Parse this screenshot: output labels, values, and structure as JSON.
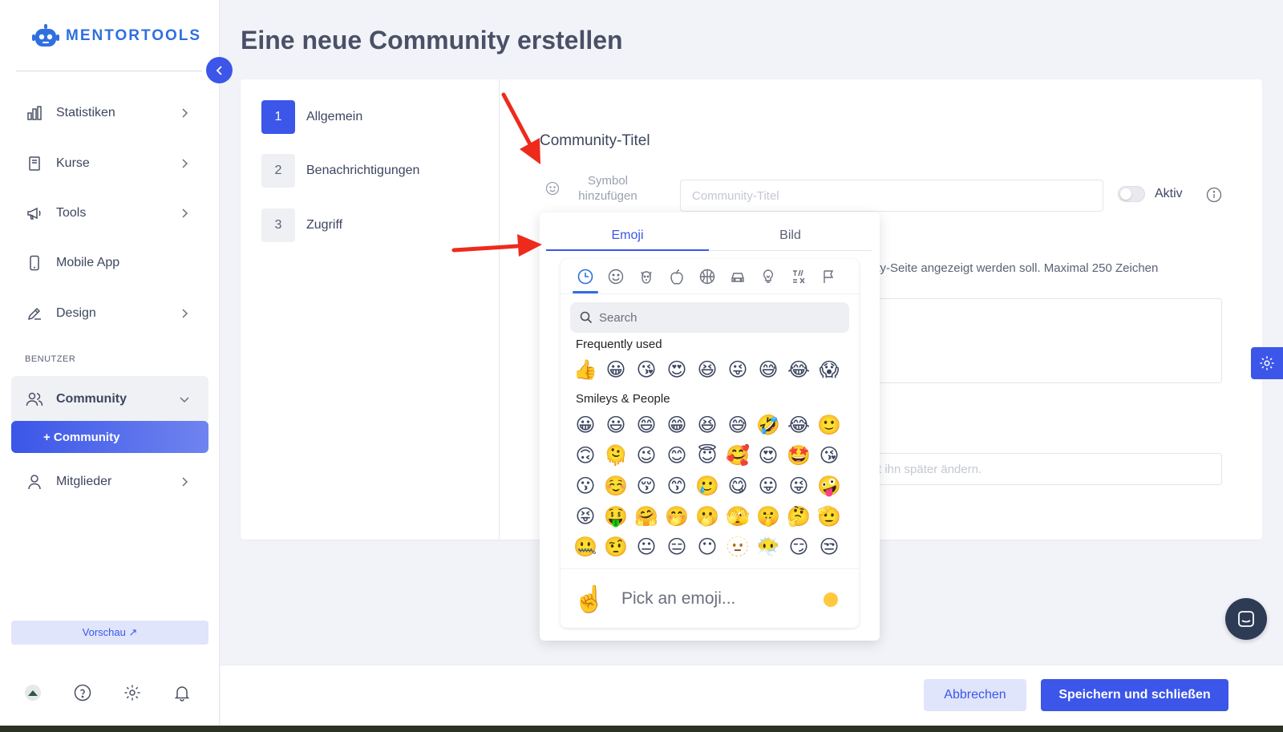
{
  "brand": {
    "name": "MENTORTOOLS"
  },
  "sidebar": {
    "items": [
      {
        "label": "Statistiken",
        "icon": "bar-chart-icon"
      },
      {
        "label": "Kurse",
        "icon": "book-icon"
      },
      {
        "label": "Tools",
        "icon": "megaphone-icon"
      },
      {
        "label": "Mobile App",
        "icon": "phone-icon"
      },
      {
        "label": "Design",
        "icon": "pencil-icon"
      }
    ],
    "section_label": "BENUTZER",
    "community": {
      "label": "Community",
      "icon": "users-icon"
    },
    "community_sub": "+ Community",
    "members": {
      "label": "Mitglieder",
      "icon": "user-icon"
    },
    "preview": "Vorschau ↗"
  },
  "page": {
    "title": "Eine neue Community erstellen"
  },
  "steps": [
    {
      "num": "1",
      "label": "Allgemein"
    },
    {
      "num": "2",
      "label": "Benachrichtigungen"
    },
    {
      "num": "3",
      "label": "Zugriff"
    }
  ],
  "form": {
    "section_title": "Community-Titel",
    "symbol_add": "Symbol hinzufügen",
    "title_placeholder": "Community-Titel",
    "active_label": "Aktiv",
    "description_hint": "ity-Seite angezeigt werden soll. Maximal 250 Zeichen",
    "second_hint": "t ihn später ändern."
  },
  "emoji_picker": {
    "tabs": [
      "Emoji",
      "Bild"
    ],
    "active_tab": "Emoji",
    "categories": [
      "clock-icon",
      "smiley-icon",
      "dog-icon",
      "apple-icon",
      "basketball-icon",
      "car-icon",
      "lightbulb-icon",
      "symbols-icon",
      "flag-icon"
    ],
    "search_placeholder": "Search",
    "frequent_title": "Frequently used",
    "frequent": [
      "👍",
      "😀",
      "😘",
      "😍",
      "😆",
      "😜",
      "😅",
      "😂",
      "😱"
    ],
    "smileys_title": "Smileys & People",
    "smileys": [
      [
        "😀",
        "😃",
        "😄",
        "😁",
        "😆",
        "😅",
        "🤣",
        "😂",
        "🙂"
      ],
      [
        "🙃",
        "🫠",
        "😉",
        "😊",
        "😇",
        "🥰",
        "😍",
        "🤩",
        "😘"
      ],
      [
        "😗",
        "☺️",
        "😚",
        "😙",
        "🥲",
        "😋",
        "😛",
        "😜",
        "🤪"
      ],
      [
        "😝",
        "🤑",
        "🤗",
        "🤭",
        "🫢",
        "🫣",
        "🤫",
        "🤔",
        "🫡"
      ],
      [
        "🤐",
        "🤨",
        "😐",
        "😑",
        "😶",
        "🫥",
        "😶‍🌫️",
        "😏",
        "😒"
      ]
    ],
    "preview_emoji": "☝️",
    "preview_text": "Pick an emoji...",
    "skin_tone_color": "#ffc83d"
  },
  "actions": {
    "cancel": "Abbrechen",
    "save": "Speichern und schließen"
  },
  "colors": {
    "primary": "#3b56e8",
    "arrow": "#ee2a1c"
  }
}
